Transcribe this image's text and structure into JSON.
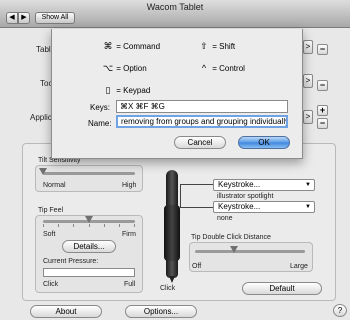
{
  "window": {
    "title": "Wacom Tablet"
  },
  "toolbar": {
    "back_glyph": "◀",
    "forward_glyph": "▶",
    "show_all": "Show All"
  },
  "side": {
    "tablet_label": "Tablet",
    "tool_label": "Tool",
    "application_label": "Application",
    "scroll_glyph": ">",
    "minus": "−",
    "plus": "+"
  },
  "tilt": {
    "label": "Tilt Sensitivity",
    "min": "Normal",
    "max": "High",
    "value_fraction": 0.0
  },
  "tip_feel": {
    "label": "Tip Feel",
    "min": "Soft",
    "max": "Firm",
    "value_fraction": 0.5,
    "details_button": "Details...",
    "pressure_label": "Current Pressure:",
    "pressure_min": "Click",
    "pressure_max": "Full",
    "pressure_value": 0.0
  },
  "pen": {
    "click_label": "Click",
    "upper_button": {
      "value": "Keystroke...",
      "caption": "illustrator spotlight"
    },
    "lower_button": {
      "value": "Keystroke...",
      "caption": "none"
    },
    "double_click": {
      "label": "Tip Double Click Distance",
      "min": "Off",
      "max": "Large",
      "value_fraction": 0.35
    }
  },
  "buttons": {
    "default": "Default",
    "about": "About",
    "options": "Options...",
    "question": "?"
  },
  "sheet": {
    "legend": {
      "command": {
        "glyph": "⌘",
        "label": "= Command"
      },
      "shift": {
        "glyph": "⇧",
        "label": "= Shift"
      },
      "option": {
        "glyph": "⌥",
        "label": "= Option"
      },
      "control": {
        "glyph": "^",
        "label": "= Control"
      },
      "keypad": {
        "glyph": "▯",
        "label": "= Keypad"
      }
    },
    "keys_label": "Keys:",
    "keys_value": "⌘X ⌘F ⌘G",
    "name_label": "Name:",
    "name_value": "removing from groups and grouping individually",
    "cancel": "Cancel",
    "ok": "OK"
  }
}
